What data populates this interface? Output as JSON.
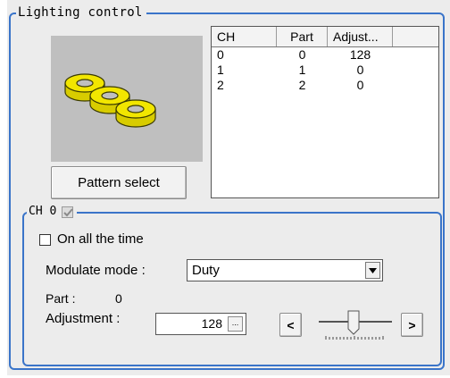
{
  "lighting_control": {
    "title": "Lighting control",
    "pattern_button_label": "Pattern select",
    "table": {
      "columns": [
        "CH",
        "Part",
        "Adjust..."
      ],
      "rows": [
        {
          "ch": "0",
          "part": "0",
          "adjust": "128"
        },
        {
          "ch": "1",
          "part": "1",
          "adjust": "0"
        },
        {
          "ch": "2",
          "part": "2",
          "adjust": "0"
        }
      ]
    }
  },
  "channel": {
    "title": "CH 0",
    "enabled": true,
    "on_all_time_label": "On all the time",
    "on_all_time_checked": false,
    "modulate_mode_label": "Modulate mode :",
    "modulate_mode_value": "Duty",
    "part_label": "Part :",
    "part_value": "0",
    "adjustment_label": "Adjustment :",
    "adjustment_value": "128",
    "dots_label": "...",
    "decrement_label": "<",
    "increment_label": ">"
  },
  "colors": {
    "group_border": "#3a74c9",
    "panel_bg": "#ececec",
    "pattern_bg": "#bfbfbf",
    "ring_yellow": "#f2e600"
  },
  "icons": [
    "ring-pattern-icon",
    "dropdown-arrow-icon",
    "checkmark-icon"
  ]
}
